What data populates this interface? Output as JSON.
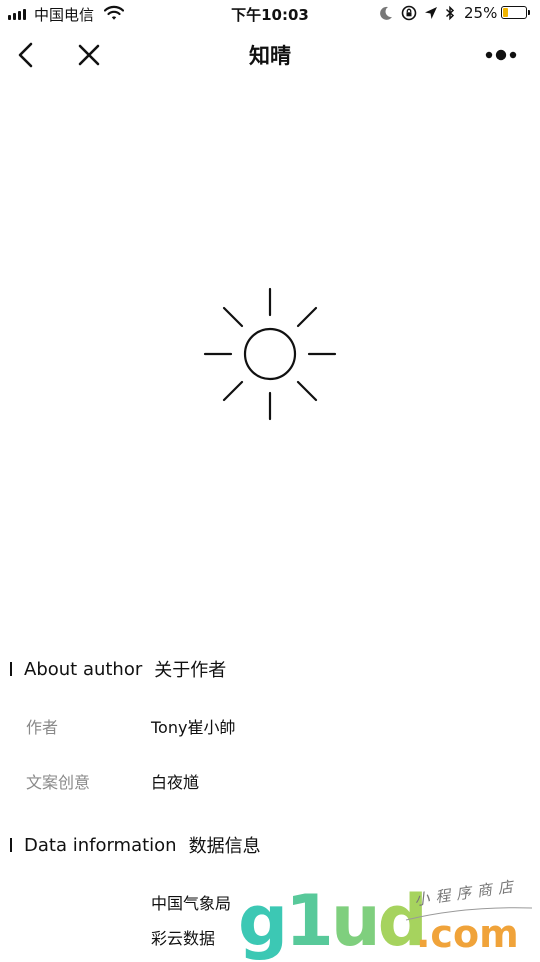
{
  "status_bar": {
    "carrier": "中国电信",
    "time": "下午10:03",
    "battery_percent": "25%",
    "battery_level": 0.25,
    "battery_color": "#f0b400",
    "icons": [
      "signal-bars-icon",
      "wifi-icon",
      "moon-icon",
      "orientation-lock-icon",
      "location-arrow-icon",
      "bluetooth-icon",
      "battery-icon"
    ]
  },
  "nav": {
    "title": "知晴",
    "icons": [
      "back-chevron-icon",
      "close-icon",
      "more-dots-icon"
    ]
  },
  "hero": {
    "icon": "sun-icon"
  },
  "about": {
    "title_en": "About author",
    "title_zh": "关于作者",
    "rows": [
      {
        "label": "作者",
        "value": "Tony崔小帥"
      },
      {
        "label": "文案创意",
        "value": "白夜馗"
      }
    ]
  },
  "data_info": {
    "title_en": "Data information",
    "title_zh": "数据信息",
    "sources": [
      "中国气象局",
      "彩云数据"
    ]
  },
  "watermark": {
    "logo": [
      "g",
      "1",
      "u",
      "d"
    ],
    "domain": ".com",
    "tagline": "小程序商店",
    "colors": [
      "#3cc8b4",
      "#58c99a",
      "#7fcf7e",
      "#a6d35e",
      "#f0a33a"
    ]
  }
}
